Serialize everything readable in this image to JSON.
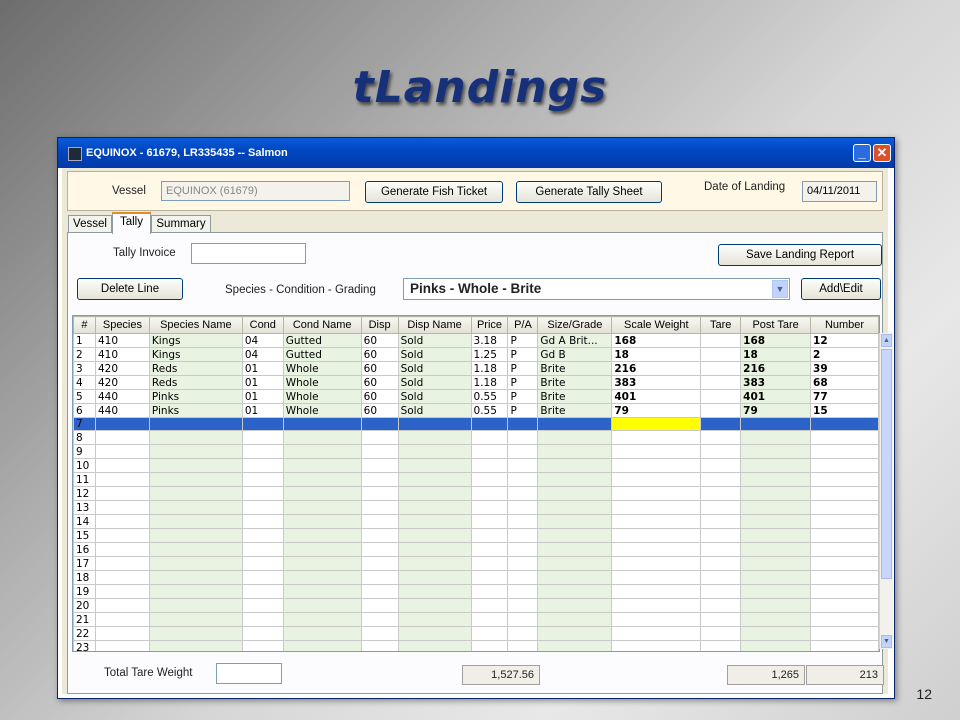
{
  "slide": {
    "title": "tLandings",
    "number": "12"
  },
  "window": {
    "title": "EQUINOX - 61679,  LR335435 -- Salmon",
    "minimize": "_",
    "close": "✕"
  },
  "header": {
    "vessel_label": "Vessel",
    "vessel_value": "EQUINOX (61679)",
    "generate_fish_ticket": "Generate Fish Ticket",
    "generate_tally_sheet": "Generate Tally Sheet",
    "date_label": "Date of Landing",
    "date_value": "04/11/2011"
  },
  "tabs": [
    "Vessel",
    "Tally",
    "Summary"
  ],
  "tally": {
    "invoice_label": "Tally Invoice",
    "invoice_value": "",
    "save_button": "Save Landing Report",
    "delete_button": "Delete Line",
    "species_label": "Species - Condition - Grading",
    "species_selected": "Pinks - Whole - Brite",
    "add_edit_button": "Add\\Edit"
  },
  "grid": {
    "columns": [
      "#",
      "Species",
      "Species Name",
      "Cond",
      "Cond Name",
      "Disp",
      "Disp Name",
      "Price",
      "P/A",
      "Size/Grade",
      "Scale Weight",
      "Tare",
      "Post Tare",
      "Number"
    ],
    "rows": [
      [
        "1",
        "410",
        "Kings",
        "04",
        "Gutted",
        "60",
        "Sold",
        "3.18",
        "P",
        "Gd A Brit...",
        "168",
        "",
        "168",
        "12"
      ],
      [
        "2",
        "410",
        "Kings",
        "04",
        "Gutted",
        "60",
        "Sold",
        "1.25",
        "P",
        "Gd B",
        "18",
        "",
        "18",
        "2"
      ],
      [
        "3",
        "420",
        "Reds",
        "01",
        "Whole",
        "60",
        "Sold",
        "1.18",
        "P",
        "Brite",
        "216",
        "",
        "216",
        "39"
      ],
      [
        "4",
        "420",
        "Reds",
        "01",
        "Whole",
        "60",
        "Sold",
        "1.18",
        "P",
        "Brite",
        "383",
        "",
        "383",
        "68"
      ],
      [
        "5",
        "440",
        "Pinks",
        "01",
        "Whole",
        "60",
        "Sold",
        "0.55",
        "P",
        "Brite",
        "401",
        "",
        "401",
        "77"
      ],
      [
        "6",
        "440",
        "Pinks",
        "01",
        "Whole",
        "60",
        "Sold",
        "0.55",
        "P",
        "Brite",
        "79",
        "",
        "79",
        "15"
      ],
      [
        "7",
        "",
        "",
        "",
        "",
        "",
        "",
        "",
        "",
        "",
        "",
        "",
        "",
        ""
      ],
      [
        "8",
        "",
        "",
        "",
        "",
        "",
        "",
        "",
        "",
        "",
        "",
        "",
        "",
        ""
      ],
      [
        "9",
        "",
        "",
        "",
        "",
        "",
        "",
        "",
        "",
        "",
        "",
        "",
        "",
        ""
      ],
      [
        "10",
        "",
        "",
        "",
        "",
        "",
        "",
        "",
        "",
        "",
        "",
        "",
        "",
        ""
      ],
      [
        "11",
        "",
        "",
        "",
        "",
        "",
        "",
        "",
        "",
        "",
        "",
        "",
        "",
        ""
      ],
      [
        "12",
        "",
        "",
        "",
        "",
        "",
        "",
        "",
        "",
        "",
        "",
        "",
        "",
        ""
      ],
      [
        "13",
        "",
        "",
        "",
        "",
        "",
        "",
        "",
        "",
        "",
        "",
        "",
        "",
        ""
      ],
      [
        "14",
        "",
        "",
        "",
        "",
        "",
        "",
        "",
        "",
        "",
        "",
        "",
        "",
        ""
      ],
      [
        "15",
        "",
        "",
        "",
        "",
        "",
        "",
        "",
        "",
        "",
        "",
        "",
        "",
        ""
      ],
      [
        "16",
        "",
        "",
        "",
        "",
        "",
        "",
        "",
        "",
        "",
        "",
        "",
        "",
        ""
      ],
      [
        "17",
        "",
        "",
        "",
        "",
        "",
        "",
        "",
        "",
        "",
        "",
        "",
        "",
        ""
      ],
      [
        "18",
        "",
        "",
        "",
        "",
        "",
        "",
        "",
        "",
        "",
        "",
        "",
        "",
        ""
      ],
      [
        "19",
        "",
        "",
        "",
        "",
        "",
        "",
        "",
        "",
        "",
        "",
        "",
        "",
        ""
      ],
      [
        "20",
        "",
        "",
        "",
        "",
        "",
        "",
        "",
        "",
        "",
        "",
        "",
        "",
        ""
      ],
      [
        "21",
        "",
        "",
        "",
        "",
        "",
        "",
        "",
        "",
        "",
        "",
        "",
        "",
        ""
      ],
      [
        "22",
        "",
        "",
        "",
        "",
        "",
        "",
        "",
        "",
        "",
        "",
        "",
        "",
        ""
      ],
      [
        "23",
        "",
        "",
        "",
        "",
        "",
        "",
        "",
        "",
        "",
        "",
        "",
        "",
        ""
      ]
    ]
  },
  "totals": {
    "tare_label": "Total Tare Weight",
    "tare_value": "",
    "price_total": "1,527.56",
    "post_tare_total": "1,265",
    "number_total": "213"
  },
  "colors": {
    "selected_row": "#2c63c9",
    "active_cell": "#ffff00",
    "titlebar": "#0047c2"
  }
}
